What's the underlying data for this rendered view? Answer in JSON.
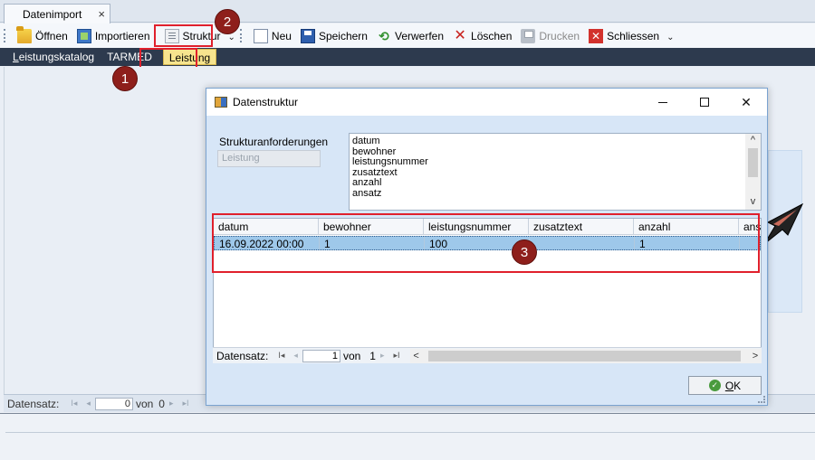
{
  "doc_tab": {
    "label": "Datenimport",
    "close": "×"
  },
  "toolbar": {
    "open": "Öffnen",
    "import": "Importieren",
    "structure": "Struktur",
    "new": "Neu",
    "save": "Speichern",
    "discard": "Verwerfen",
    "delete": "Löschen",
    "print": "Drucken",
    "close": "Schliessen",
    "more": "⌄"
  },
  "subtabs": {
    "catalog_prefix": "L",
    "catalog_rest": "eistungskatalog",
    "tarmed": "TARMED",
    "service": "Leistung"
  },
  "badges": {
    "one": "1",
    "two": "2",
    "three": "3"
  },
  "dialog": {
    "title": "Datenstruktur",
    "minimize": "",
    "maximize": "",
    "close": "✕",
    "requirements_label": "Strukturanforderungen",
    "requirements_value": "Leistung",
    "structure_items": [
      "datum",
      "bewohner",
      "leistungsnummer",
      "zusatztext",
      "anzahl",
      "ansatz"
    ],
    "scroll_up": "^",
    "scroll_down": "v",
    "grid": {
      "columns": [
        "datum",
        "bewohner",
        "leistungsnummer",
        "zusatztext",
        "anzahl",
        "ansa"
      ],
      "rows": [
        [
          "16.09.2022 00:00",
          "1",
          "100",
          "",
          "1",
          ""
        ]
      ]
    },
    "navigator": {
      "label": "Datensatz:",
      "first": "I◂",
      "prev": "◂",
      "current": "1",
      "of": "von",
      "total": "1",
      "next": "▸",
      "last": "▸I",
      "scroll_left": "<",
      "scroll_right": ">"
    },
    "ok_label": "OK",
    "ok_mnemonic": "O",
    "ok_rest": "K"
  },
  "main_navigator": {
    "label": "Datensatz:",
    "first": "I◂",
    "prev": "◂",
    "current": "0",
    "of": "von",
    "total": "0",
    "next": "▸",
    "last": "▸I"
  },
  "colors": {
    "accent_red": "#e0202c",
    "badge": "#8e1f1b",
    "subtab_bar": "#2d3a4e",
    "active_subtab": "#f7e48e",
    "selected_row": "#9ec8ea"
  }
}
